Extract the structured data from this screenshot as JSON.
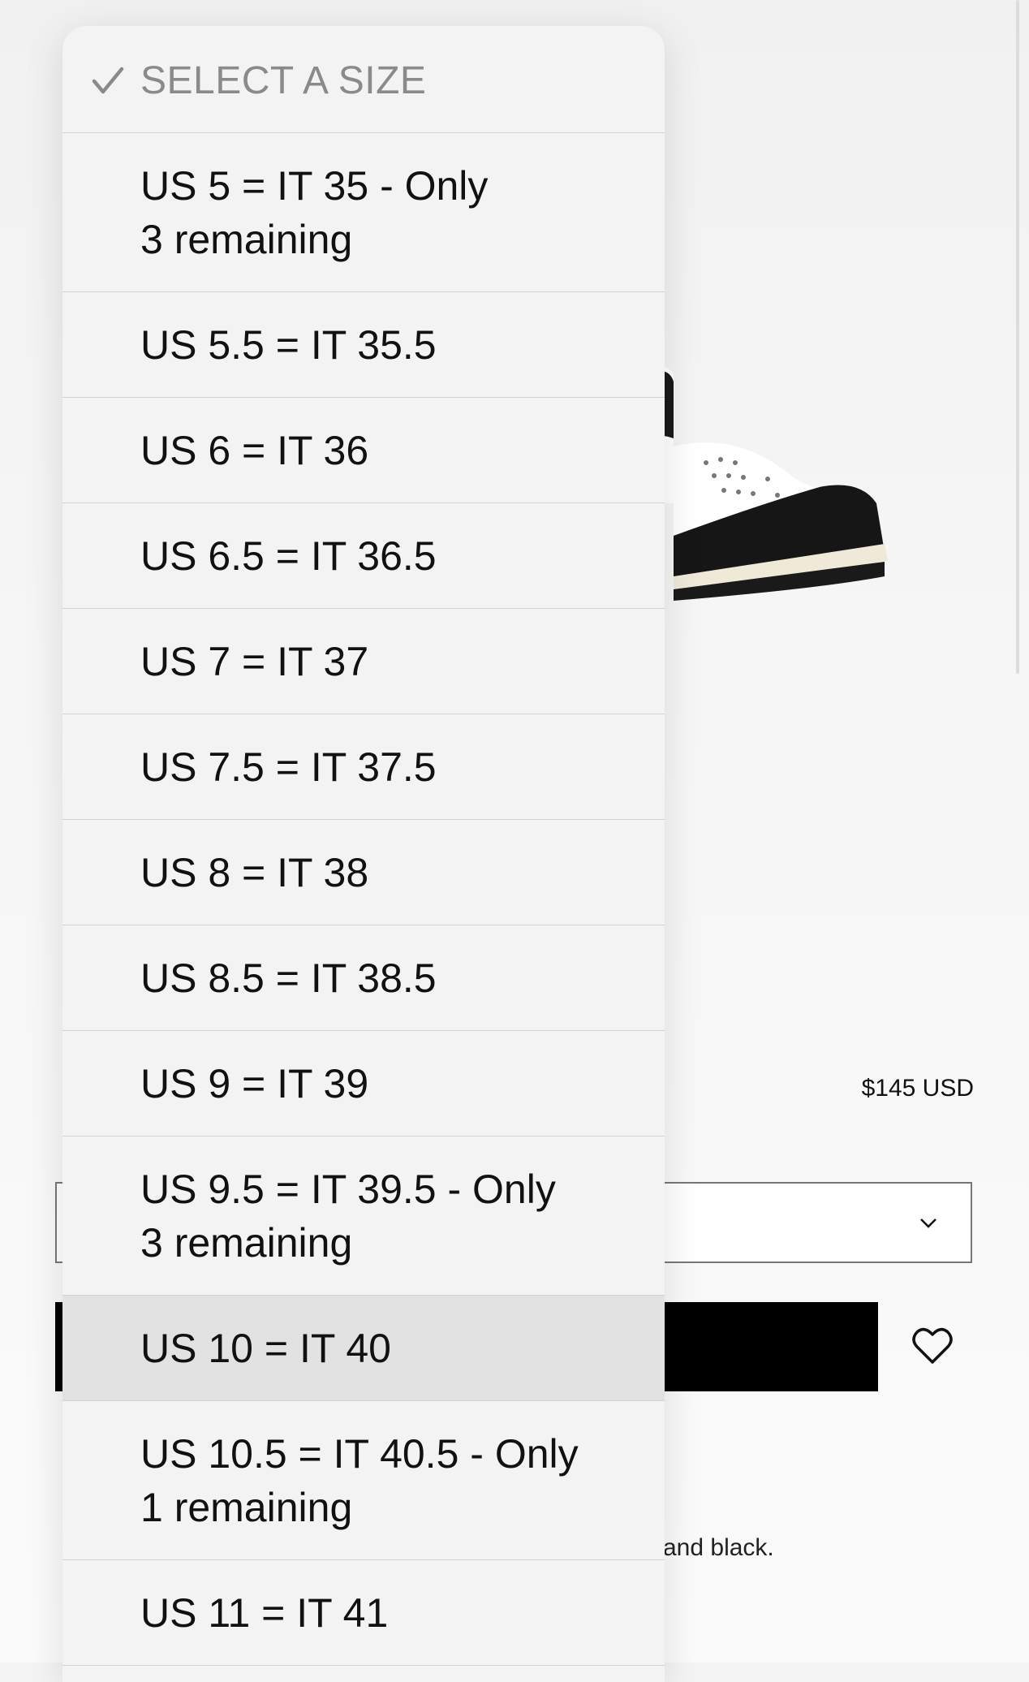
{
  "product": {
    "price": "$145 USD",
    "description_tail": "and black."
  },
  "size_dropdown": {
    "header": "SELECT A SIZE",
    "options": [
      {
        "label": "US 5 = IT 35 - Only\n3 remaining"
      },
      {
        "label": "US 5.5 = IT 35.5"
      },
      {
        "label": "US 6 = IT 36"
      },
      {
        "label": "US 6.5 = IT 36.5"
      },
      {
        "label": "US 7 = IT 37"
      },
      {
        "label": "US 7.5 = IT 37.5"
      },
      {
        "label": "US 8 = IT 38"
      },
      {
        "label": "US 8.5 = IT 38.5"
      },
      {
        "label": "US 9 = IT 39"
      },
      {
        "label": "US 9.5 = IT 39.5 - Only\n3 remaining"
      },
      {
        "label": "US 10 = IT 40"
      },
      {
        "label": "US 10.5 = IT 40.5 - Only\n1 remaining"
      },
      {
        "label": "US 11 = IT 41"
      }
    ]
  },
  "icons": {
    "check": "check-icon",
    "chevron": "chevron-down-icon",
    "heart": "heart-icon"
  }
}
